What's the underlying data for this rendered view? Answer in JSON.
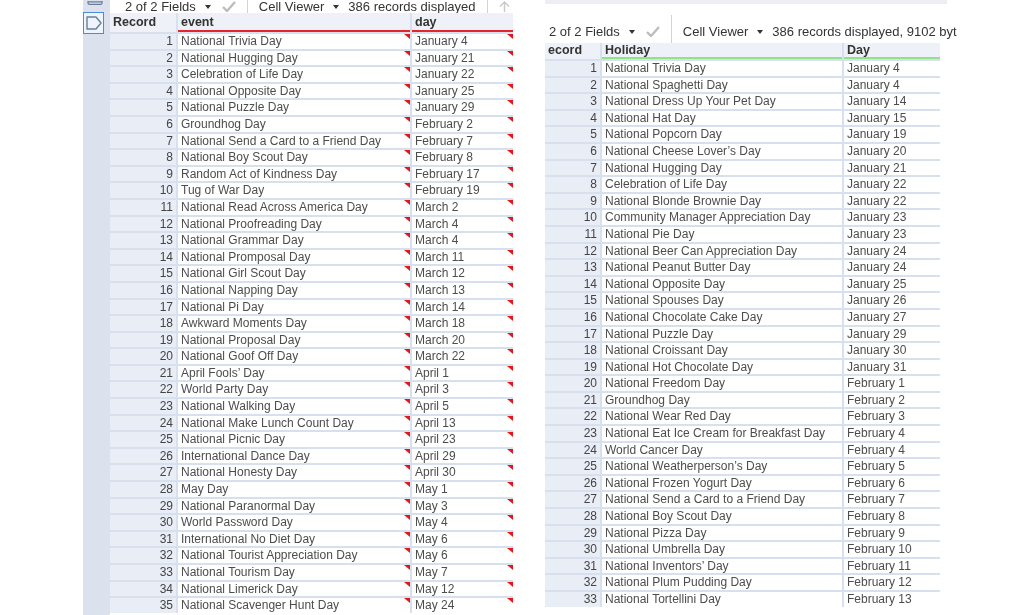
{
  "left_panel": {
    "side_tools": [
      {
        "kind": "rectangle",
        "selected": false
      },
      {
        "kind": "tag",
        "selected": true
      }
    ],
    "toolbar": [
      {
        "kind": "menu",
        "label": "2 of 2 Fields"
      },
      {
        "kind": "check",
        "disabled": true
      },
      {
        "kind": "separator"
      },
      {
        "kind": "menu",
        "label": "Cell Viewer"
      },
      {
        "kind": "status",
        "text": "386 records displayed"
      },
      {
        "kind": "separator"
      },
      {
        "kind": "up",
        "disabled": true
      }
    ],
    "columns": [
      {
        "label": "Record"
      },
      {
        "label": "event",
        "flagged": true
      },
      {
        "label": "day",
        "flagged": true
      }
    ],
    "rows": [
      [
        "1",
        "National Trivia Day",
        "January 4"
      ],
      [
        "2",
        "National Hugging Day",
        "January 21"
      ],
      [
        "3",
        "Celebration of Life Day",
        "January 22"
      ],
      [
        "4",
        "National Opposite Day",
        "January 25"
      ],
      [
        "5",
        "National Puzzle Day",
        "January 29"
      ],
      [
        "6",
        "Groundhog Day",
        "February 2"
      ],
      [
        "7",
        "National Send a Card to a Friend Day",
        "February 7"
      ],
      [
        "8",
        "National Boy Scout Day",
        "February 8"
      ],
      [
        "9",
        "Random Act of Kindness Day",
        "February 17"
      ],
      [
        "10",
        "Tug of War Day",
        "February 19"
      ],
      [
        "11",
        "National Read Across America Day",
        "March 2"
      ],
      [
        "12",
        "National Proofreading Day",
        "March 4"
      ],
      [
        "13",
        "National Grammar Day",
        "March 4"
      ],
      [
        "14",
        "National Promposal Day",
        "March 11"
      ],
      [
        "15",
        "National Girl Scout Day",
        "March 12"
      ],
      [
        "16",
        "National Napping Day",
        "March 13"
      ],
      [
        "17",
        "National Pi Day",
        "March 14"
      ],
      [
        "18",
        "Awkward Moments Day",
        "March 18"
      ],
      [
        "19",
        "National Proposal Day",
        "March 20"
      ],
      [
        "20",
        "National Goof Off Day",
        "March 22"
      ],
      [
        "21",
        "April Fools’ Day",
        "April 1"
      ],
      [
        "22",
        "World Party Day",
        "April 3"
      ],
      [
        "23",
        "National Walking Day",
        "April 5"
      ],
      [
        "24",
        "National Make Lunch Count Day",
        "April 13"
      ],
      [
        "25",
        "National Picnic Day",
        "April 23"
      ],
      [
        "26",
        "International Dance Day",
        "April 29"
      ],
      [
        "27",
        "National Honesty Day",
        "April 30"
      ],
      [
        "28",
        "May Day",
        "May 1"
      ],
      [
        "29",
        "National Paranormal Day",
        "May 3"
      ],
      [
        "30",
        "World Password Day",
        "May 4"
      ],
      [
        "31",
        "International No Diet Day",
        "May 6"
      ],
      [
        "32",
        "National Tourist Appreciation Day",
        "May 6"
      ],
      [
        "33",
        "National Tourism Day",
        "May 7"
      ],
      [
        "34",
        "National Limerick Day",
        "May 12"
      ],
      [
        "35",
        "National Scavenger Hunt Day",
        "May 24"
      ]
    ]
  },
  "right_panel": {
    "toolbar": [
      {
        "kind": "menu",
        "label": "2 of 2 Fields"
      },
      {
        "kind": "check",
        "disabled": true
      },
      {
        "kind": "separator"
      },
      {
        "kind": "menu",
        "label": "Cell Viewer"
      },
      {
        "kind": "status",
        "text": "386 records displayed, 9102 byt"
      }
    ],
    "columns": [
      {
        "label": "ecord"
      },
      {
        "label": "Holiday",
        "flagged": false
      },
      {
        "label": "Day",
        "flagged": false
      }
    ],
    "rows": [
      [
        "1",
        "National Trivia Day",
        "January 4"
      ],
      [
        "2",
        "National Spaghetti Day",
        "January 4"
      ],
      [
        "3",
        "National Dress Up Your Pet Day",
        "January 14"
      ],
      [
        "4",
        "National Hat Day",
        "January 15"
      ],
      [
        "5",
        "National Popcorn Day",
        "January 19"
      ],
      [
        "6",
        "National Cheese Lover’s Day",
        "January 20"
      ],
      [
        "7",
        "National Hugging Day",
        "January 21"
      ],
      [
        "8",
        "Celebration of Life Day",
        "January 22"
      ],
      [
        "9",
        "National Blonde Brownie Day",
        "January 22"
      ],
      [
        "10",
        "Community Manager Appreciation Day",
        "January 23"
      ],
      [
        "11",
        "National Pie Day",
        "January 23"
      ],
      [
        "12",
        "National Beer Can Appreciation Day",
        "January 24"
      ],
      [
        "13",
        "National Peanut Butter Day",
        "January 24"
      ],
      [
        "14",
        "National Opposite Day",
        "January 25"
      ],
      [
        "15",
        "National Spouses Day",
        "January 26"
      ],
      [
        "16",
        "National Chocolate Cake Day",
        "January 27"
      ],
      [
        "17",
        "National Puzzle Day",
        "January 29"
      ],
      [
        "18",
        "National Croissant Day",
        "January 30"
      ],
      [
        "19",
        "National Hot Chocolate Day",
        "January 31"
      ],
      [
        "20",
        "National Freedom Day",
        "February 1"
      ],
      [
        "21",
        "Groundhog Day",
        "February 2"
      ],
      [
        "22",
        "National Wear Red Day",
        "February 3"
      ],
      [
        "23",
        "National Eat Ice Cream for Breakfast Day",
        "February 4"
      ],
      [
        "24",
        "World Cancer Day",
        "February 4"
      ],
      [
        "25",
        "National Weatherperson’s Day",
        "February 5"
      ],
      [
        "26",
        "National Frozen Yogurt Day",
        "February 6"
      ],
      [
        "27",
        "National Send a Card to a Friend Day",
        "February 7"
      ],
      [
        "28",
        "National Boy Scout Day",
        "February 8"
      ],
      [
        "29",
        "National Pizza Day",
        "February 9"
      ],
      [
        "30",
        "National Umbrella Day",
        "February 10"
      ],
      [
        "31",
        "National Inventors’ Day",
        "February 11"
      ],
      [
        "32",
        "National Plum Pudding Day",
        "February 12"
      ],
      [
        "33",
        "National Tortellini Day",
        "February 13"
      ]
    ]
  }
}
